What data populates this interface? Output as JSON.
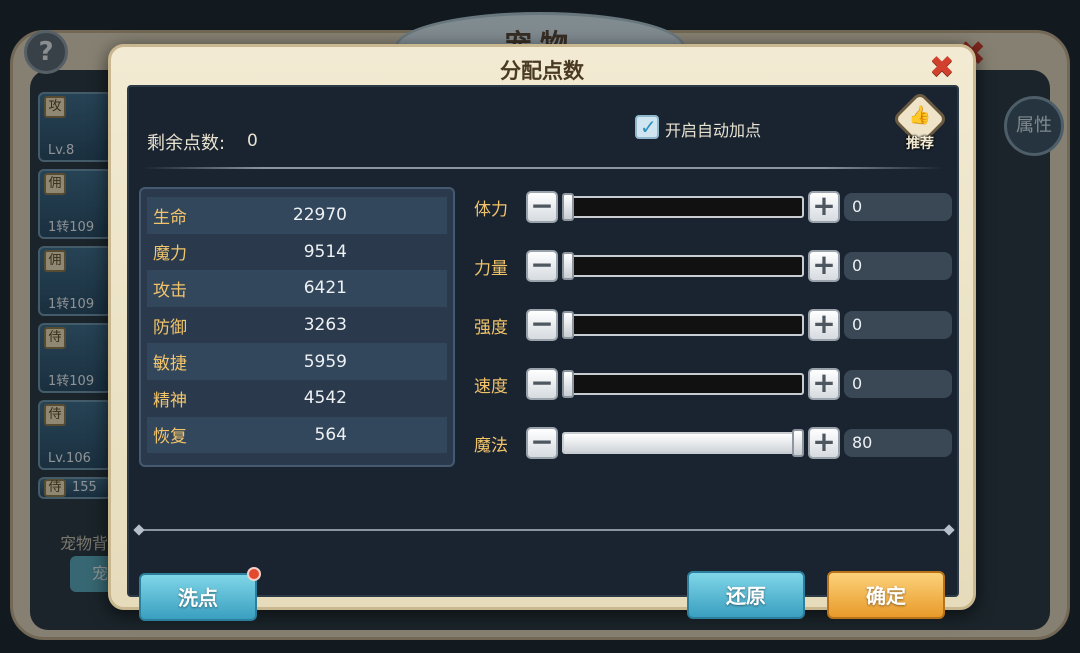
{
  "background": {
    "title": "宠物",
    "help_glyph": "?",
    "close_glyph": "✖",
    "attribute_button": "属性",
    "pet_bag_label": "宠物背",
    "pet_sub_button": "宠",
    "pets": [
      {
        "tag": "攻",
        "level": "Lv.8"
      },
      {
        "tag": "佣",
        "level": "1转109"
      },
      {
        "tag": "佣",
        "level": "1转109"
      },
      {
        "tag": "侍",
        "level": "1转109"
      },
      {
        "tag": "侍",
        "level": "Lv.106"
      },
      {
        "tag": "侍",
        "level": "155"
      }
    ]
  },
  "dialog": {
    "title": "分配点数",
    "close_glyph": "✖",
    "remaining_label": "剩余点数:",
    "remaining_value": "0",
    "auto_add_label": "开启自动加点",
    "auto_add_checked": true,
    "recommend_label": "推荐",
    "recommend_icon": "thumbs-up-icon",
    "stats": [
      {
        "name": "生命",
        "value": "22970"
      },
      {
        "name": "魔力",
        "value": "9514"
      },
      {
        "name": "攻击",
        "value": "6421"
      },
      {
        "name": "防御",
        "value": "3263"
      },
      {
        "name": "敏捷",
        "value": "5959"
      },
      {
        "name": "精神",
        "value": "4542"
      },
      {
        "name": "恢复",
        "value": "564"
      }
    ],
    "sliders": [
      {
        "label": "体力",
        "value": "0",
        "fraction": 0.0
      },
      {
        "label": "力量",
        "value": "0",
        "fraction": 0.0
      },
      {
        "label": "强度",
        "value": "0",
        "fraction": 0.0
      },
      {
        "label": "速度",
        "value": "0",
        "fraction": 0.0
      },
      {
        "label": "魔法",
        "value": "80",
        "fraction": 1.0
      }
    ],
    "minus_glyph": "−",
    "plus_glyph": "+",
    "buttons": {
      "wash": "洗点",
      "restore": "还原",
      "confirm": "确定"
    }
  }
}
